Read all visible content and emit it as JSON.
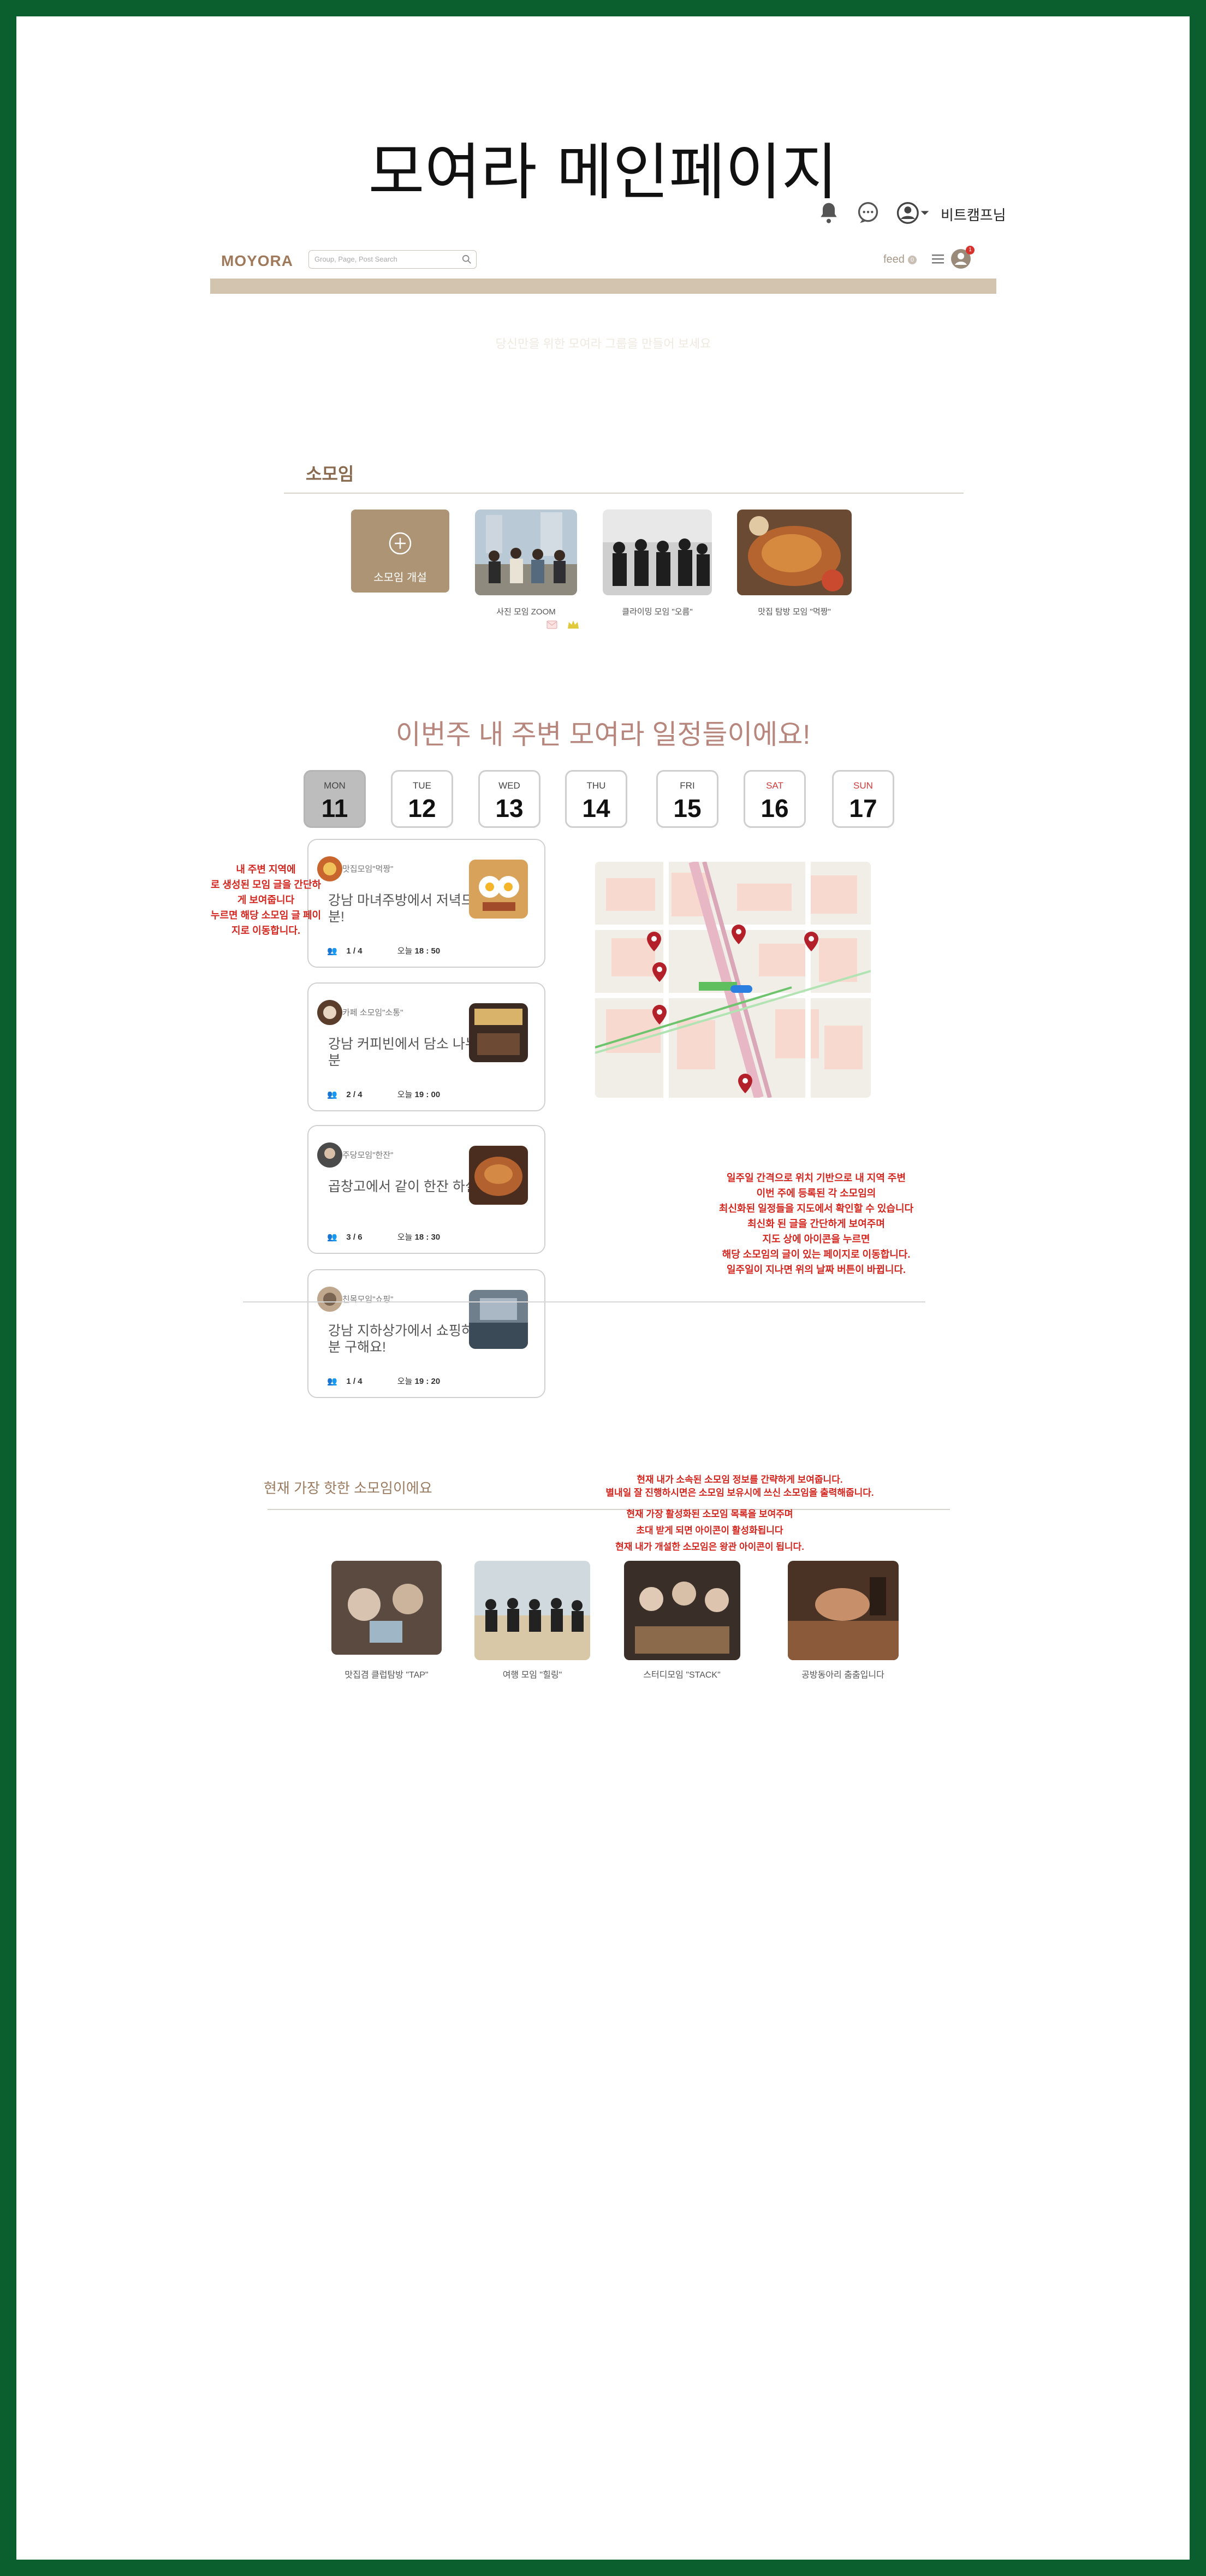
{
  "page_title": "모여라 메인페이지",
  "topbar": {
    "username": "비트캠프님"
  },
  "nav": {
    "logo": "MOYORA",
    "search_placeholder": "Group, Page, Post Search",
    "feed_label": "feed",
    "feed_count": "0",
    "notification_count": "1"
  },
  "banner_text": "당신만을 위한 모여라 그룹을 만들어 보세요",
  "groups_section": {
    "title": "소모임",
    "create_label": "소모임 개설",
    "groups": [
      {
        "caption": "사진 모임 ZOOM"
      },
      {
        "caption": "클라이밍 모임 \"오름\""
      },
      {
        "caption": "맛집 탐방 모임 \"먹짱\""
      }
    ]
  },
  "schedule": {
    "title": "이번주 내 주변 모여라 일정들이에요!",
    "days": [
      {
        "name": "MON",
        "num": "11",
        "active": true
      },
      {
        "name": "TUE",
        "num": "12"
      },
      {
        "name": "WED",
        "num": "13"
      },
      {
        "name": "THU",
        "num": "14"
      },
      {
        "name": "FRI",
        "num": "15"
      },
      {
        "name": "SAT",
        "num": "16",
        "weekend": true
      },
      {
        "name": "SUN",
        "num": "17",
        "weekend": true
      }
    ],
    "posts": [
      {
        "group": "맛집모임\"먹짱\"",
        "text": "강남 마녀주방에서 저녁드실 분!",
        "members": "1 / 4",
        "time_prefix": "오늘",
        "time": "18 : 50"
      },
      {
        "group": "카페 소모임\"소통\"",
        "text": "강남 커피빈에서 담소 나누실 분",
        "members": "2 / 4",
        "time_prefix": "오늘",
        "time": "19 : 00"
      },
      {
        "group": "주당모임\"한잔\"",
        "text": "곱창고에서 같이 한잔 하실분",
        "members": "3 / 6",
        "time_prefix": "오늘",
        "time": "18 : 30"
      },
      {
        "group": "친목모임\"쇼핑\"",
        "text": "강남 지하상가에서 쇼핑하실 분 구해요!",
        "members": "1 / 4",
        "time_prefix": "오늘",
        "time": "19 : 20"
      }
    ]
  },
  "annotations": {
    "left_note": [
      "내 주변 지역에",
      "로 생성된 모임 글을 간단하",
      "게 보여줍니다",
      "누르면 해당 소모임 글 페이",
      "지로 이동합니다."
    ],
    "map_note": [
      "일주일 간격으로 위치 기반으로 내 지역 주변",
      "이번 주에 등록된 각 소모임의",
      "최신화된 일정들을 지도에서 확인할 수 있습니다",
      "최신화 된 글을 간단하게 보여주며",
      "지도 상에 아이콘을 누르면",
      "해당 소모임의 글이 있는 페이지로 이동합니다.",
      "일주일이 지나면 위의 날짜 버튼이 바뀝니다."
    ],
    "hot_note_a": [
      "현재 내가 소속된 소모임 정보를 간략하게 보여줍니다.",
      "별내일 잘 진행하시면은 소모임 보유시에 쓰신 소모임을 출력해줍니다."
    ],
    "hot_note_b": [
      "현재 가장 활성화된 소모임 목록을 보여주며",
      "초대 받게 되면 아이콘이 활성화됩니다",
      "현재 내가 개설한 소모임은 왕관 아이콘이 됩니다."
    ]
  },
  "hot_section": {
    "title": "현재 가장 핫한 소모임이에요",
    "groups": [
      {
        "caption": "맛집겸 클럽탐방 \"TAP\""
      },
      {
        "caption": "여행 모임 \"힐링\""
      },
      {
        "caption": "스터디모임 \"STACK\""
      },
      {
        "caption": "공방동아리 춤춤입니다"
      }
    ]
  },
  "colors": {
    "frame": "#0b5e2e",
    "brand": "#a0785a",
    "banner": "#d2c4ae",
    "annotation": "#d3261f",
    "map_pin": "#b3202a"
  }
}
